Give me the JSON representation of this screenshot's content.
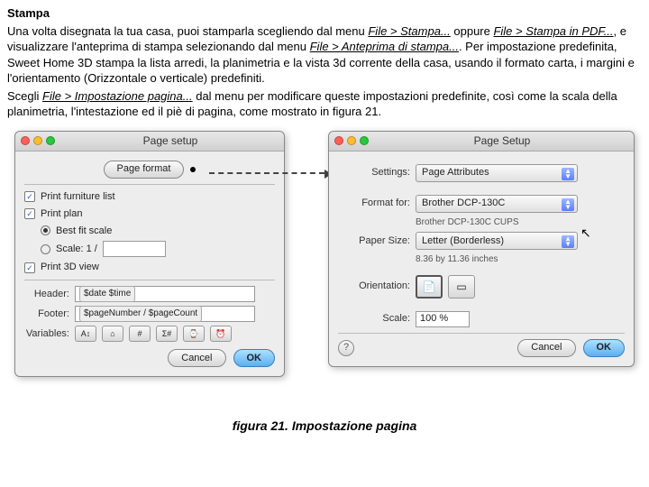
{
  "heading": "Stampa",
  "para1_parts": {
    "t1": "Una volta disegnata la tua casa, puoi stamparla scegliendo dal menu ",
    "m1": "File > Stampa...",
    "t2": " oppure ",
    "m2": "File > Stampa in PDF...",
    "t3": ", e visualizzare l'anteprima di stampa selezionando dal menu ",
    "m3": "File > Anteprima di stampa...",
    "t4": ". Per impostazione predefinita, Sweet Home 3D stampa la lista arredi, la planimetria e la vista 3d corrente della casa, usando il formato carta, i margini e l'orientamento (Orizzontale o verticale) predefiniti."
  },
  "para2_parts": {
    "t1": "Scegli ",
    "m1": "File > Impostazione pagina...",
    "t2": " dal menu per modificare queste impostazioni predefinite, così come la scala della planimetria, l'intestazione ed il piè di pagina, come mostrato in figura 21."
  },
  "dialog_left": {
    "title": "Page setup",
    "page_format_label": "Page format",
    "print_furniture": "Print furniture list",
    "print_plan": "Print plan",
    "best_fit": "Best fit scale",
    "scale_label": "Scale: 1 /",
    "scale_value": "",
    "print_3d": "Print 3D view",
    "header_label": "Header:",
    "header_tokens": [
      "$date $time"
    ],
    "footer_label": "Footer:",
    "footer_tokens": [
      "$pageNumber / $pageCount"
    ],
    "variables_label": "Variables:",
    "var_buttons": [
      "A↕",
      "⌂",
      "#",
      "Σ#",
      "⌚",
      "⏰"
    ],
    "cancel": "Cancel",
    "ok": "OK"
  },
  "dialog_right": {
    "title": "Page Setup",
    "settings_label": "Settings:",
    "settings_value": "Page Attributes",
    "format_for_label": "Format for:",
    "format_for_value": "Brother DCP-130C",
    "format_for_note": "Brother DCP-130C CUPS",
    "paper_size_label": "Paper Size:",
    "paper_size_value": "Letter (Borderless)",
    "paper_size_note": "8.36 by 11.36 inches",
    "orientation_label": "Orientation:",
    "scale_label": "Scale:",
    "scale_value": "100 %",
    "cancel": "Cancel",
    "ok": "OK"
  },
  "caption": "figura 21. Impostazione pagina"
}
